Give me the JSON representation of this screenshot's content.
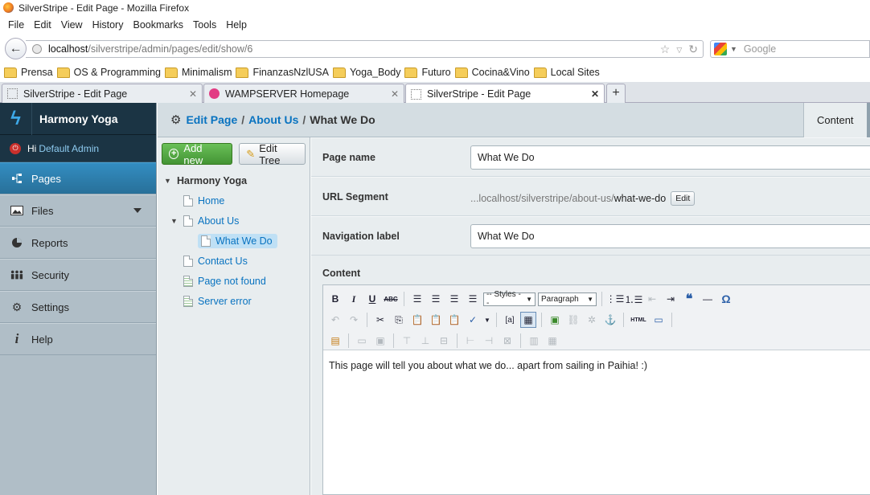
{
  "window": {
    "title": "SilverStripe - Edit Page - Mozilla Firefox"
  },
  "menubar": {
    "items": [
      "File",
      "Edit",
      "View",
      "History",
      "Bookmarks",
      "Tools",
      "Help"
    ]
  },
  "navbar": {
    "url_host": "localhost",
    "url_path": "/silverstripe/admin/pages/edit/show/6",
    "search_placeholder": "Google"
  },
  "bookmarks": [
    "Prensa",
    "OS & Programming",
    "Minimalism",
    "FinanzasNzlUSA",
    "Yoga_Body",
    "Futuro",
    "Cocina&Vino",
    "Local Sites"
  ],
  "tabs": [
    {
      "label": "SilverStripe - Edit Page",
      "active": false
    },
    {
      "label": "WAMPSERVER Homepage",
      "active": false
    },
    {
      "label": "SilverStripe - Edit Page",
      "active": true
    }
  ],
  "cms": {
    "site_name": "Harmony Yoga",
    "user_greeting": "Hi",
    "user_name": "Default Admin",
    "menu": [
      {
        "label": "Pages",
        "icon": "sitemap-icon",
        "current": true
      },
      {
        "label": "Files",
        "icon": "image-icon",
        "current": false
      },
      {
        "label": "Reports",
        "icon": "pie-chart-icon",
        "current": false
      },
      {
        "label": "Security",
        "icon": "users-icon",
        "current": false
      },
      {
        "label": "Settings",
        "icon": "gear-icon",
        "current": false
      },
      {
        "label": "Help",
        "icon": "info-icon",
        "current": false
      }
    ],
    "breadcrumb": {
      "edit_page": "Edit Page",
      "parent": "About Us",
      "current": "What We Do",
      "sep": "/"
    },
    "header_tab": "Content",
    "tree_actions": {
      "add_new": "Add new",
      "edit_tree": "Edit Tree"
    },
    "tree": {
      "root": "Harmony Yoga",
      "home": "Home",
      "about_us": "About Us",
      "what_we_do": "What We Do",
      "contact_us": "Contact Us",
      "page_not_found": "Page not found",
      "server_error": "Server error"
    },
    "form": {
      "page_name_label": "Page name",
      "page_name_value": "What We Do",
      "url_segment_label": "URL Segment",
      "url_segment_prefix": "...localhost/silverstripe/about-us/",
      "url_segment_value": "what-we-do",
      "url_segment_edit": "Edit",
      "nav_label_label": "Navigation label",
      "nav_label_value": "What We Do",
      "content_label": "Content",
      "styles_select": "-- Styles --",
      "format_select": "Paragraph",
      "html_button": "HTML",
      "content_text": "This page will tell you about what we do... apart from sailing in Paihia! :)"
    }
  },
  "colors": {
    "cms_dark": "#1b3444",
    "cms_menu": "#b0bec7",
    "menu_active": "#287099",
    "link": "#0973c0",
    "add_button": "#4fa23e",
    "panel_bg": "#e8edef"
  }
}
